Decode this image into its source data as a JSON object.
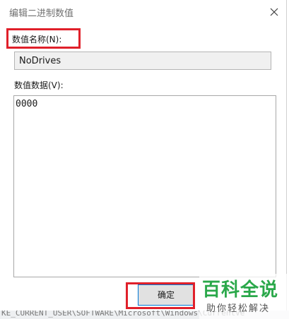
{
  "window": {
    "title": "编辑二进制数值",
    "close_icon": "close-icon"
  },
  "value_name": {
    "label": "数值名称(N):",
    "value": "NoDrives"
  },
  "value_data": {
    "label": "数值数据(V):",
    "value": "0000"
  },
  "buttons": {
    "ok_label": "确定"
  },
  "background_text": "KE_CURRENT_USER\\SOFTWARE\\Microsoft\\Windows\\CurrentVe",
  "watermark": {
    "title": "百科全说",
    "subtitle": "助你轻松解决"
  },
  "colors": {
    "highlight": "#e0202a",
    "accent": "#0078d7",
    "watermark_green": "#2aa84a"
  }
}
